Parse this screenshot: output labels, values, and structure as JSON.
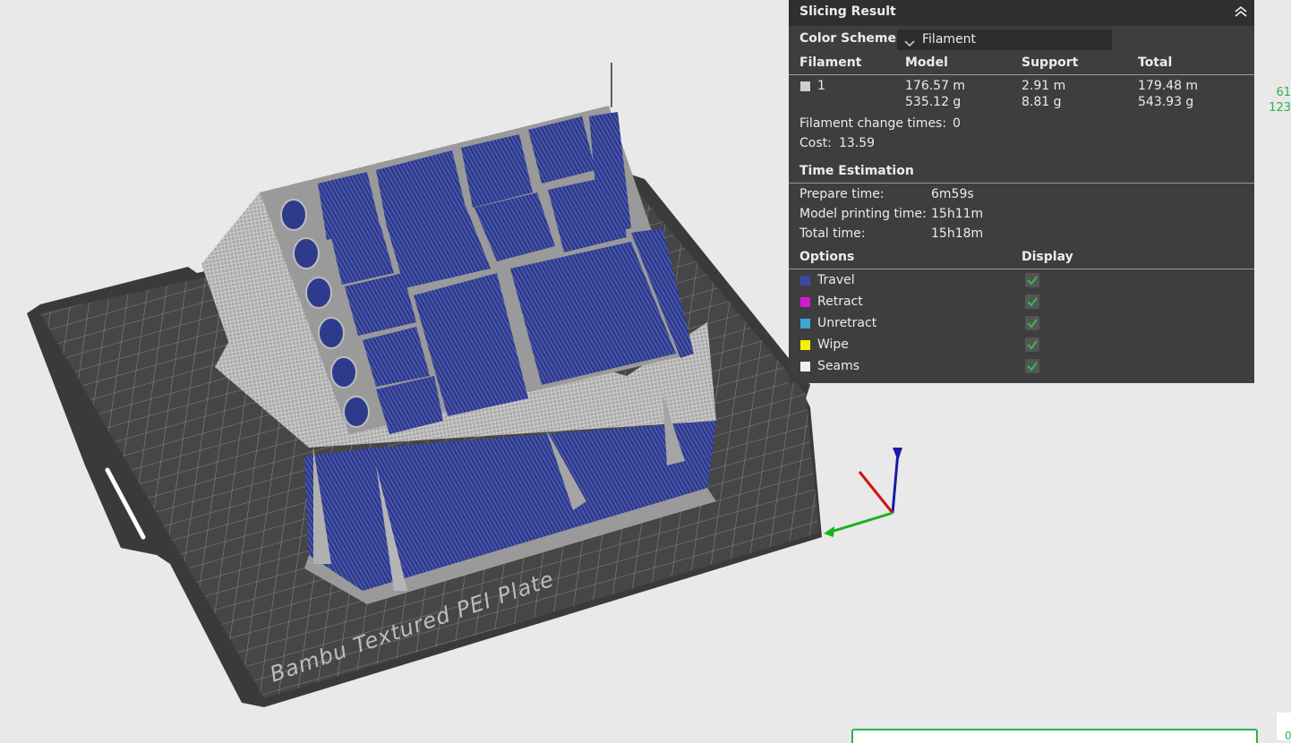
{
  "viewport": {
    "plate_label": "Bambu Textured PEI Plate"
  },
  "panel": {
    "title": "Slicing Result",
    "color_scheme_label": "Color Scheme",
    "color_scheme_value": "Filament",
    "headers": {
      "filament": "Filament",
      "model": "Model",
      "support": "Support",
      "total": "Total"
    },
    "row": {
      "id": "1",
      "model_len": "176.57 m",
      "model_wt": "535.12 g",
      "support_len": "2.91 m",
      "support_wt": "8.81 g",
      "total_len": "179.48 m",
      "total_wt": "543.93 g",
      "swatch_color": "#cfcfcf"
    },
    "filament_change_label": "Filament change times:",
    "filament_change_value": "0",
    "cost_label": "Cost:",
    "cost_value": "13.59",
    "time_heading": "Time Estimation",
    "prepare_label": "Prepare time:",
    "prepare_value": "6m59s",
    "model_print_label": "Model printing time:",
    "model_print_value": "15h11m",
    "total_time_label": "Total time:",
    "total_time_value": "15h18m",
    "options_heading": "Options",
    "display_heading": "Display",
    "options": [
      {
        "label": "Travel",
        "color": "#3b4aa0",
        "checked": true
      },
      {
        "label": "Retract",
        "color": "#d21bd2",
        "checked": true
      },
      {
        "label": "Unretract",
        "color": "#3aa9d6",
        "checked": true
      },
      {
        "label": "Wipe",
        "color": "#f2f200",
        "checked": true
      },
      {
        "label": "Seams",
        "color": "#f0f0f0",
        "checked": true
      }
    ]
  },
  "side_numbers": {
    "top": "61",
    "bottom": "123"
  },
  "corner_text": "0"
}
